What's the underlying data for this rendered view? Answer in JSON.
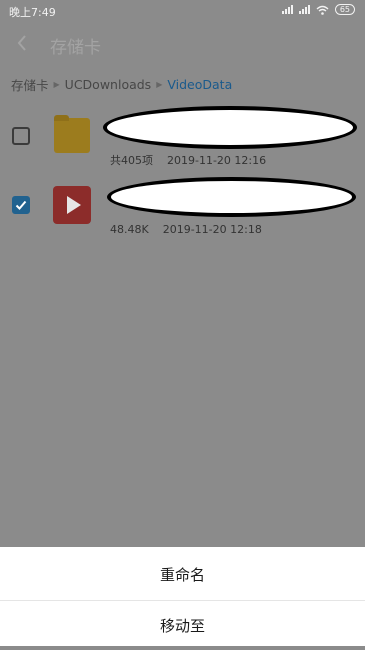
{
  "status_bar": {
    "time": "晚上7:49",
    "battery": "65",
    "icons": [
      "signal-icon",
      "signal-hd-icon",
      "wifi-icon",
      "battery-icon"
    ]
  },
  "app_bar": {
    "title": "存储卡",
    "back_icon": "chevron-left-icon"
  },
  "breadcrumb": {
    "items": [
      "存储卡",
      "UCDownloads",
      "VideoData"
    ]
  },
  "files": [
    {
      "type": "folder",
      "checked": false,
      "name": "",
      "count": "共405项",
      "date": "2019-11-20 12:16",
      "icon": "folder-icon"
    },
    {
      "type": "video",
      "checked": true,
      "name": "",
      "size": "48.48K",
      "date": "2019-11-20 12:18",
      "icon": "video-play-icon"
    }
  ],
  "bottom_sheet": {
    "rename": "重命名",
    "move_to": "移动至"
  },
  "colors": {
    "overlay": "#8b8b8b",
    "accent": "#21628f",
    "folder": "#9c7c1e",
    "video": "#8c2c2a"
  }
}
